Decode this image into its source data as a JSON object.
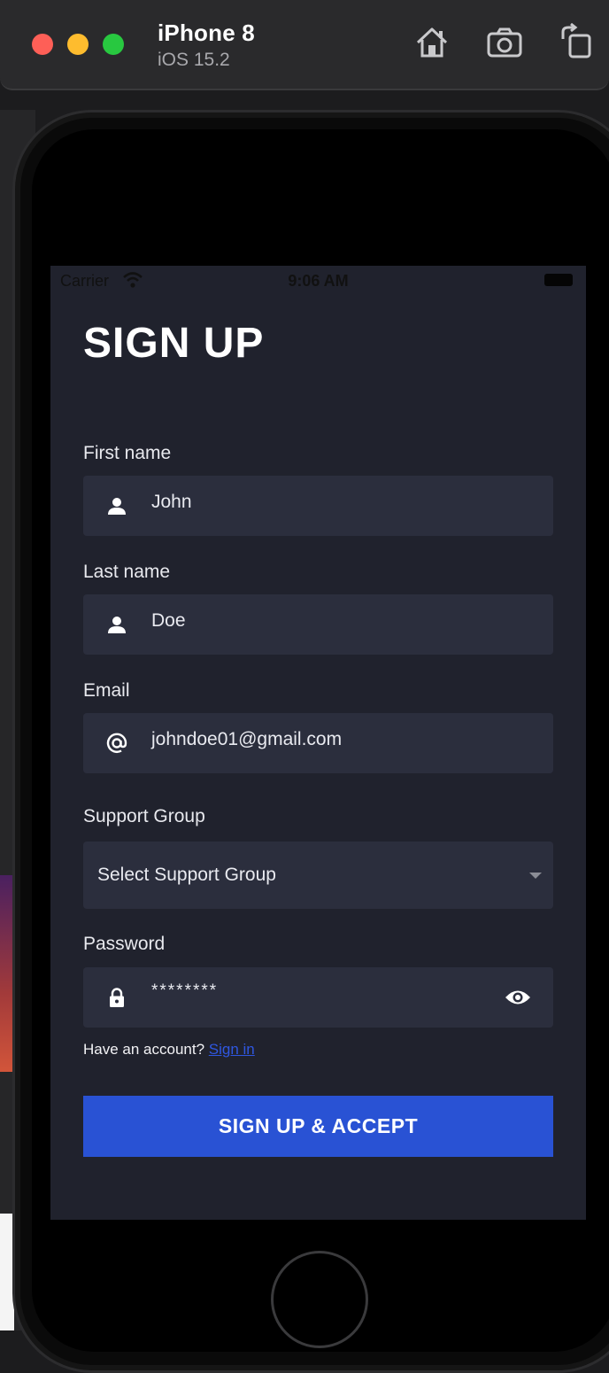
{
  "simulator": {
    "device_name": "iPhone 8",
    "os_version": "iOS 15.2",
    "toolbar_icons": [
      "home-icon",
      "screenshot-icon",
      "rotate-icon"
    ]
  },
  "status_bar": {
    "carrier": "Carrier",
    "time": "9:06 AM"
  },
  "form": {
    "title": "SIGN UP",
    "first_name": {
      "label": "First name",
      "value": "John",
      "icon": "person-icon"
    },
    "last_name": {
      "label": "Last name",
      "value": "Doe",
      "icon": "person-icon"
    },
    "email": {
      "label": "Email",
      "value": "johndoe01@gmail.com",
      "icon": "at-icon"
    },
    "support_group": {
      "label": "Support Group",
      "value": "Select Support Group"
    },
    "password": {
      "label": "Password",
      "value": "********",
      "icon": "lock-icon"
    },
    "have_account_text": "Have an account?",
    "sign_in_link": "Sign in",
    "submit_label": "SIGN UP & ACCEPT"
  },
  "colors": {
    "background": "#20222d",
    "field": "#2b2e3d",
    "accent": "#2952d4",
    "link": "#2f57e0"
  }
}
